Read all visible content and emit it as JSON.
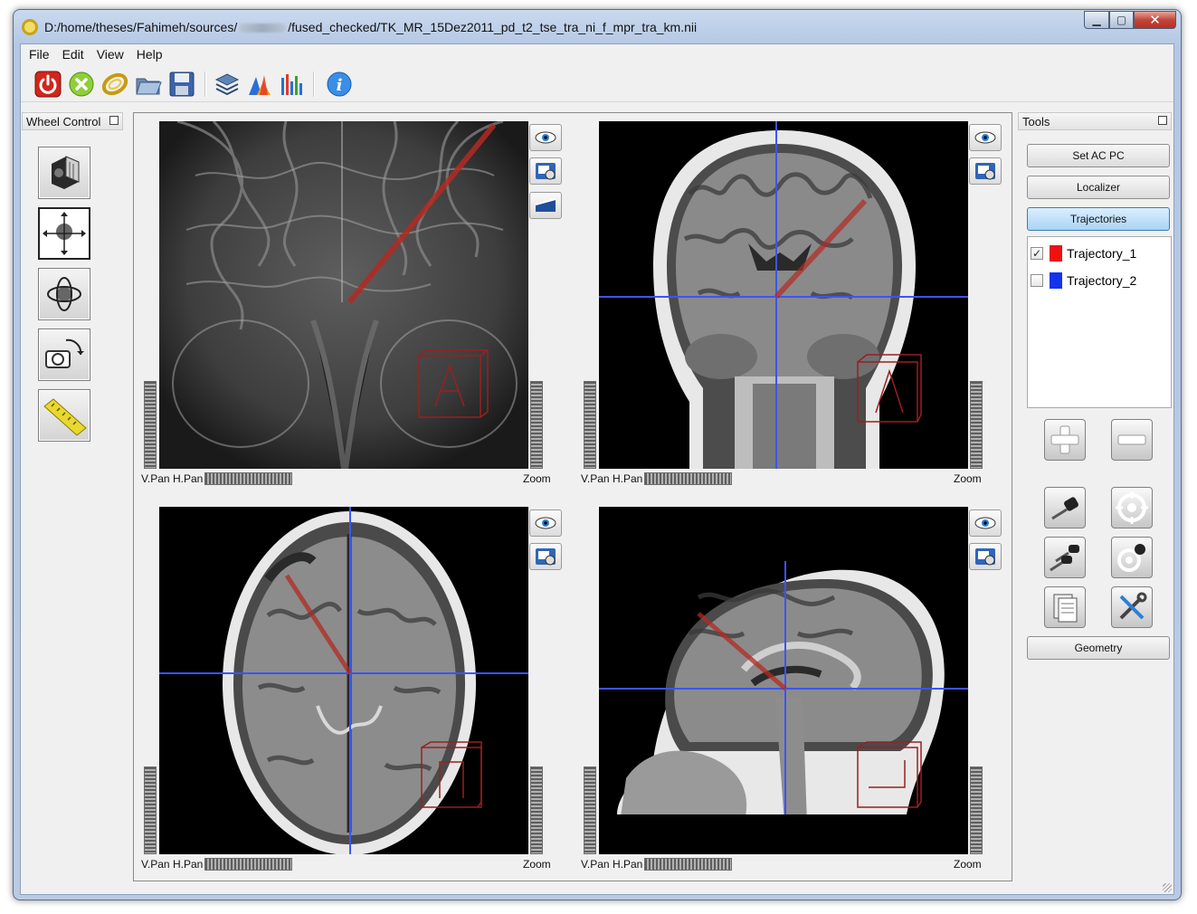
{
  "window": {
    "title_prefix": "D:/home/theses/Fahimeh/sources/",
    "title_suffix": "/fused_checked/TK_MR_15Dez2011_pd_t2_tse_tra_ni_f_mpr_tra_km.nii",
    "close_glyph": "✕",
    "min_glyph": "▁",
    "max_glyph": "▢"
  },
  "menu": [
    "File",
    "Edit",
    "View",
    "Help"
  ],
  "toolbar": {
    "icons": [
      "power-icon",
      "cancel-icon",
      "link-icon",
      "open-folder-icon",
      "save-icon",
      "layers-icon",
      "volume-icon",
      "histogram-icon",
      "info-icon"
    ]
  },
  "left_dock": {
    "title": "Wheel Control",
    "tools": [
      "volume-tool",
      "pan-tool",
      "rotate-tool",
      "camera-rotate-tool",
      "ruler-tool"
    ],
    "selected": "pan-tool"
  },
  "views": [
    {
      "name": "3D",
      "vpan": "V.Pan",
      "hpan": "H.Pan",
      "zoom": "Zoom"
    },
    {
      "name": "coronal",
      "vpan": "V.Pan",
      "hpan": "H.Pan",
      "zoom": "Zoom"
    },
    {
      "name": "axial",
      "vpan": "V.Pan",
      "hpan": "H.Pan",
      "zoom": "Zoom"
    },
    {
      "name": "sagittal",
      "vpan": "V.Pan",
      "hpan": "H.Pan",
      "zoom": "Zoom"
    }
  ],
  "right_dock": {
    "title": "Tools",
    "buttons": {
      "set_ac_pc": "Set AC PC",
      "localizer": "Localizer",
      "trajectories": "Trajectories",
      "geometry": "Geometry"
    },
    "trajectories": [
      {
        "label": "Trajectory_1",
        "checked": true,
        "color": "#ee1111"
      },
      {
        "label": "Trajectory_2",
        "checked": false,
        "color": "#1133ee"
      }
    ],
    "check_glyph": "✓"
  },
  "colors": {
    "crosshair": "#3a55ff",
    "trajectory": "#b32a22",
    "accent": "#3c7fb1"
  }
}
